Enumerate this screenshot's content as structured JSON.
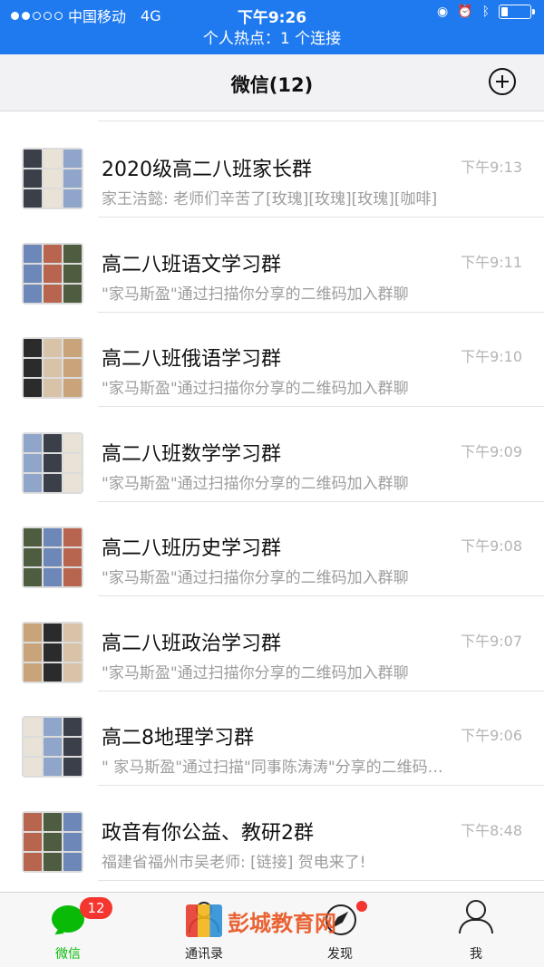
{
  "status_bar": {
    "carrier": "中国移动",
    "network": "4G",
    "time": "下午9:26",
    "hotspot": "个人热点：1 个连接"
  },
  "nav": {
    "title": "微信(12)",
    "add_icon": "plus-circle-icon"
  },
  "chats": [
    {
      "title": "2020级高二八班家长群",
      "preview": "家王洁懿: 老师们辛苦了[玫瑰][玫瑰][玫瑰][咖啡]",
      "time": "下午9:13"
    },
    {
      "title": "高二八班语文学习群",
      "preview": "\"家马斯盈\"通过扫描你分享的二维码加入群聊",
      "time": "下午9:11"
    },
    {
      "title": "高二八班俄语学习群",
      "preview": "\"家马斯盈\"通过扫描你分享的二维码加入群聊",
      "time": "下午9:10"
    },
    {
      "title": "高二八班数学学习群",
      "preview": "\"家马斯盈\"通过扫描你分享的二维码加入群聊",
      "time": "下午9:09"
    },
    {
      "title": "高二八班历史学习群",
      "preview": "\"家马斯盈\"通过扫描你分享的二维码加入群聊",
      "time": "下午9:08"
    },
    {
      "title": "高二八班政治学习群",
      "preview": "\"家马斯盈\"通过扫描你分享的二维码加入群聊",
      "time": "下午9:07"
    },
    {
      "title": "高二8地理学习群",
      "preview": "\" 家马斯盈\"通过扫描\"同事陈涛涛\"分享的二维码…",
      "time": "下午9:06"
    },
    {
      "title": "政音有你公益、教研2群",
      "preview": "福建省福州市吴老师: [链接] 贺电来了!",
      "time": "下午8:48"
    }
  ],
  "tabbar": {
    "tabs": [
      {
        "label": "微信",
        "icon": "chat-icon",
        "badge": "12"
      },
      {
        "label": "通讯录",
        "icon": "contacts-icon"
      },
      {
        "label": "发现",
        "icon": "compass-icon"
      },
      {
        "label": "我",
        "icon": "person-icon"
      }
    ]
  },
  "watermark": "彭城教育网",
  "colors": {
    "status_bar": "#1f7af0",
    "accent": "#09bb07",
    "badge": "#f43530"
  }
}
